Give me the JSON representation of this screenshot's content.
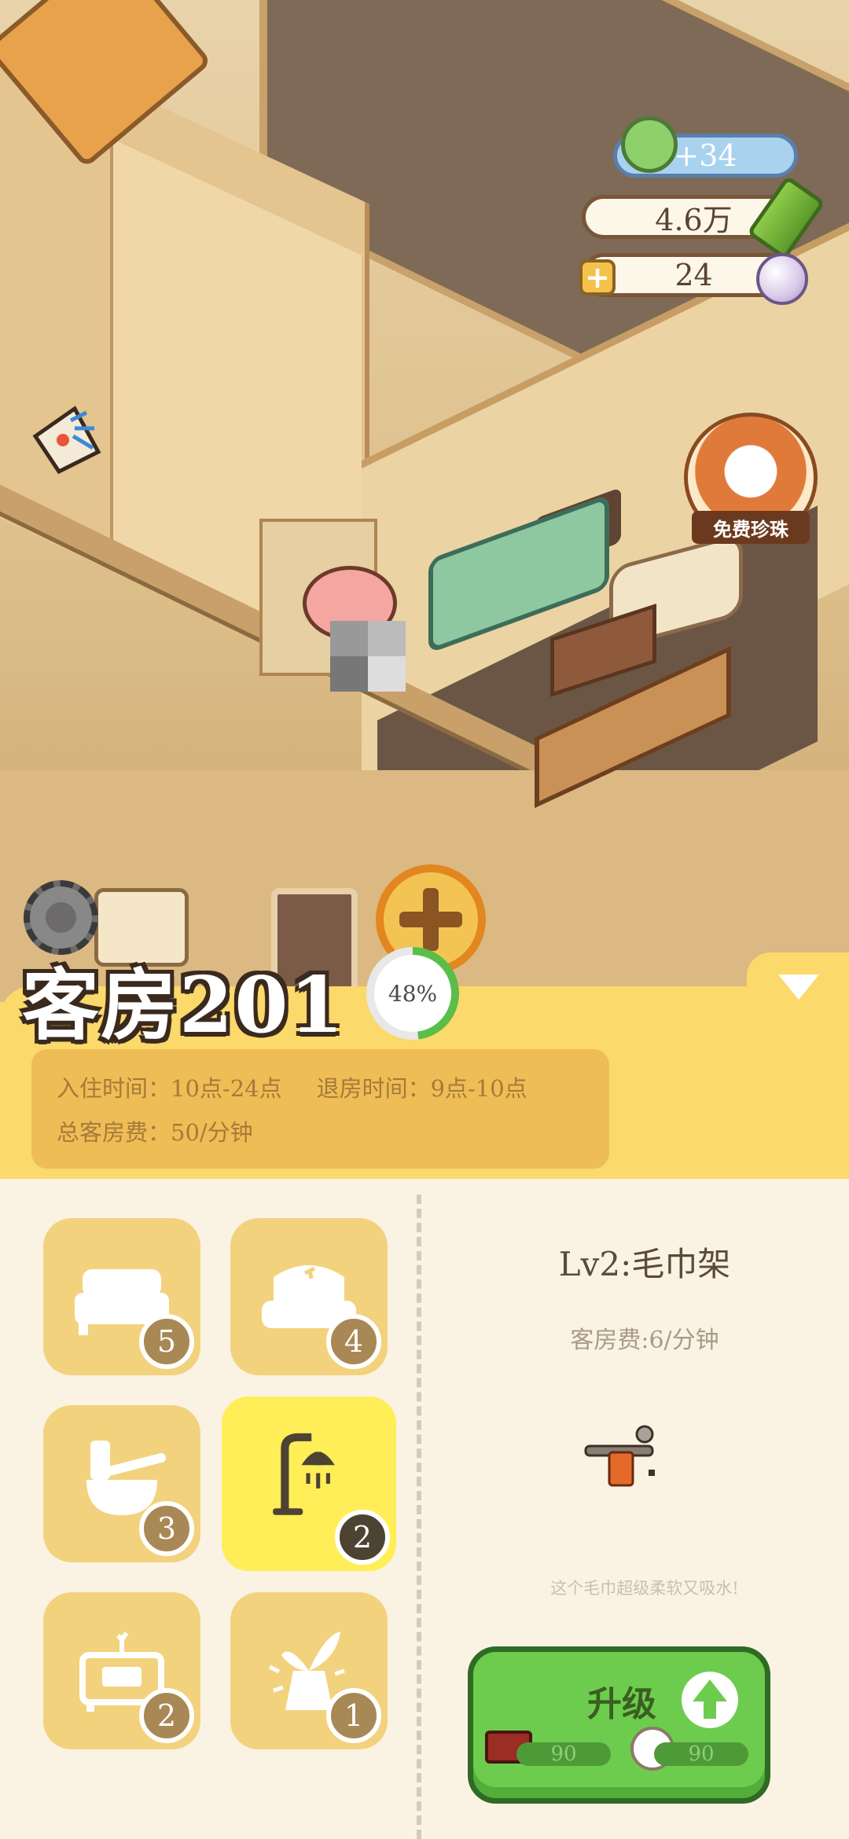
{
  "hud": {
    "bamboo_gain": "+34",
    "bamboo": "4.6万",
    "pearls": "24",
    "plus_symbol": "+"
  },
  "free_pearl": {
    "label": "免费珍珠"
  },
  "room": {
    "title": "客房201",
    "progress_text": "48%",
    "progress_value": 48,
    "checkin_time": "入住时间：10点-24点",
    "checkout_time": "退房时间：9点-10点",
    "total_fee": "总客房费：50/分钟"
  },
  "categories": [
    {
      "icon": "bed-icon",
      "count": "5"
    },
    {
      "icon": "sofa-icon",
      "count": "4"
    },
    {
      "icon": "toilet-icon",
      "count": "3"
    },
    {
      "icon": "shower-icon",
      "count": "2",
      "active": true
    },
    {
      "icon": "cabinet-icon",
      "count": "2"
    },
    {
      "icon": "plant-icon",
      "count": "1"
    }
  ],
  "item": {
    "title": "Lv2:毛巾架",
    "fee": "客房费:6/分钟",
    "description": "这个毛巾超级柔软又吸水!"
  },
  "upgrade": {
    "label": "升级",
    "cost_wood": "90",
    "cost_cotton": "90"
  },
  "colors": {
    "panel_yellow": "#fbd96a",
    "active_tile": "#ffee58",
    "upgrade_green": "#6dcc4d"
  }
}
